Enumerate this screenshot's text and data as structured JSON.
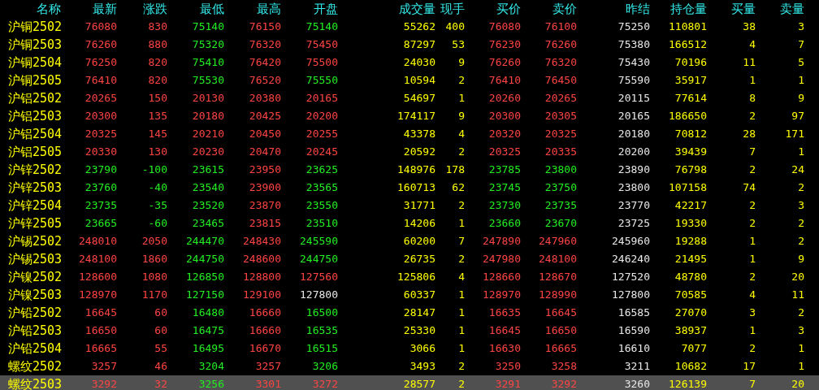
{
  "table": {
    "columns": [
      {
        "label": "名称"
      },
      {
        "label": "最新"
      },
      {
        "label": "涨跌"
      },
      {
        "label": "最低"
      },
      {
        "label": "最高"
      },
      {
        "label": "开盘"
      },
      {
        "label": "成交量"
      },
      {
        "label": "现手"
      },
      {
        "label": "买价"
      },
      {
        "label": "卖价"
      },
      {
        "label": "昨结"
      },
      {
        "label": "持仓量"
      },
      {
        "label": "买量"
      },
      {
        "label": "卖量"
      }
    ],
    "rows": [
      {
        "name": "沪铜2502",
        "selected": false,
        "last": {
          "text": "76080",
          "color": "#ff4444"
        },
        "change": {
          "text": "830",
          "color": "#ff4444"
        },
        "low": {
          "text": "75140",
          "color": "#22ee22"
        },
        "high": {
          "text": "76150",
          "color": "#ff4444"
        },
        "open": {
          "text": "75140",
          "color": "#22ee22"
        },
        "volume": "55262",
        "current": "400",
        "bid": {
          "text": "76080",
          "color": "#ff4444"
        },
        "ask": {
          "text": "76100",
          "color": "#ff4444"
        },
        "prev_settle": "75250",
        "open_interest": "110801",
        "bid_vol": "38",
        "ask_vol": "3"
      },
      {
        "name": "沪铜2503",
        "selected": false,
        "last": {
          "text": "76260",
          "color": "#ff4444"
        },
        "change": {
          "text": "880",
          "color": "#ff4444"
        },
        "low": {
          "text": "75320",
          "color": "#22ee22"
        },
        "high": {
          "text": "76320",
          "color": "#ff4444"
        },
        "open": {
          "text": "75450",
          "color": "#ff4444"
        },
        "volume": "87297",
        "current": "53",
        "bid": {
          "text": "76230",
          "color": "#ff4444"
        },
        "ask": {
          "text": "76260",
          "color": "#ff4444"
        },
        "prev_settle": "75380",
        "open_interest": "166512",
        "bid_vol": "4",
        "ask_vol": "7"
      },
      {
        "name": "沪铜2504",
        "selected": false,
        "last": {
          "text": "76250",
          "color": "#ff4444"
        },
        "change": {
          "text": "820",
          "color": "#ff4444"
        },
        "low": {
          "text": "75410",
          "color": "#22ee22"
        },
        "high": {
          "text": "76420",
          "color": "#ff4444"
        },
        "open": {
          "text": "75500",
          "color": "#ff4444"
        },
        "volume": "24030",
        "current": "9",
        "bid": {
          "text": "76260",
          "color": "#ff4444"
        },
        "ask": {
          "text": "76320",
          "color": "#ff4444"
        },
        "prev_settle": "75430",
        "open_interest": "70196",
        "bid_vol": "11",
        "ask_vol": "5"
      },
      {
        "name": "沪铜2505",
        "selected": false,
        "last": {
          "text": "76410",
          "color": "#ff4444"
        },
        "change": {
          "text": "820",
          "color": "#ff4444"
        },
        "low": {
          "text": "75530",
          "color": "#22ee22"
        },
        "high": {
          "text": "76520",
          "color": "#ff4444"
        },
        "open": {
          "text": "75550",
          "color": "#22ee22"
        },
        "volume": "10594",
        "current": "2",
        "bid": {
          "text": "76410",
          "color": "#ff4444"
        },
        "ask": {
          "text": "76450",
          "color": "#ff4444"
        },
        "prev_settle": "75590",
        "open_interest": "35917",
        "bid_vol": "1",
        "ask_vol": "1"
      },
      {
        "name": "沪铝2502",
        "selected": false,
        "last": {
          "text": "20265",
          "color": "#ff4444"
        },
        "change": {
          "text": "150",
          "color": "#ff4444"
        },
        "low": {
          "text": "20130",
          "color": "#ff4444"
        },
        "high": {
          "text": "20380",
          "color": "#ff4444"
        },
        "open": {
          "text": "20165",
          "color": "#ff4444"
        },
        "volume": "54697",
        "current": "1",
        "bid": {
          "text": "20260",
          "color": "#ff4444"
        },
        "ask": {
          "text": "20265",
          "color": "#ff4444"
        },
        "prev_settle": "20115",
        "open_interest": "77614",
        "bid_vol": "8",
        "ask_vol": "9"
      },
      {
        "name": "沪铝2503",
        "selected": false,
        "last": {
          "text": "20300",
          "color": "#ff4444"
        },
        "change": {
          "text": "135",
          "color": "#ff4444"
        },
        "low": {
          "text": "20180",
          "color": "#ff4444"
        },
        "high": {
          "text": "20425",
          "color": "#ff4444"
        },
        "open": {
          "text": "20200",
          "color": "#ff4444"
        },
        "volume": "174117",
        "current": "9",
        "bid": {
          "text": "20300",
          "color": "#ff4444"
        },
        "ask": {
          "text": "20305",
          "color": "#ff4444"
        },
        "prev_settle": "20165",
        "open_interest": "186650",
        "bid_vol": "2",
        "ask_vol": "97"
      },
      {
        "name": "沪铝2504",
        "selected": false,
        "last": {
          "text": "20325",
          "color": "#ff4444"
        },
        "change": {
          "text": "145",
          "color": "#ff4444"
        },
        "low": {
          "text": "20210",
          "color": "#ff4444"
        },
        "high": {
          "text": "20450",
          "color": "#ff4444"
        },
        "open": {
          "text": "20255",
          "color": "#ff4444"
        },
        "volume": "43378",
        "current": "4",
        "bid": {
          "text": "20320",
          "color": "#ff4444"
        },
        "ask": {
          "text": "20325",
          "color": "#ff4444"
        },
        "prev_settle": "20180",
        "open_interest": "70812",
        "bid_vol": "28",
        "ask_vol": "171"
      },
      {
        "name": "沪铝2505",
        "selected": false,
        "last": {
          "text": "20330",
          "color": "#ff4444"
        },
        "change": {
          "text": "130",
          "color": "#ff4444"
        },
        "low": {
          "text": "20230",
          "color": "#ff4444"
        },
        "high": {
          "text": "20470",
          "color": "#ff4444"
        },
        "open": {
          "text": "20245",
          "color": "#ff4444"
        },
        "volume": "20592",
        "current": "2",
        "bid": {
          "text": "20325",
          "color": "#ff4444"
        },
        "ask": {
          "text": "20335",
          "color": "#ff4444"
        },
        "prev_settle": "20200",
        "open_interest": "39439",
        "bid_vol": "7",
        "ask_vol": "1"
      },
      {
        "name": "沪锌2502",
        "selected": false,
        "last": {
          "text": "23790",
          "color": "#22ee22"
        },
        "change": {
          "text": "-100",
          "color": "#22ee22"
        },
        "low": {
          "text": "23615",
          "color": "#22ee22"
        },
        "high": {
          "text": "23950",
          "color": "#ff4444"
        },
        "open": {
          "text": "23625",
          "color": "#22ee22"
        },
        "volume": "148976",
        "current": "178",
        "bid": {
          "text": "23785",
          "color": "#22ee22"
        },
        "ask": {
          "text": "23800",
          "color": "#22ee22"
        },
        "prev_settle": "23890",
        "open_interest": "76798",
        "bid_vol": "2",
        "ask_vol": "24"
      },
      {
        "name": "沪锌2503",
        "selected": false,
        "last": {
          "text": "23760",
          "color": "#22ee22"
        },
        "change": {
          "text": "-40",
          "color": "#22ee22"
        },
        "low": {
          "text": "23540",
          "color": "#22ee22"
        },
        "high": {
          "text": "23900",
          "color": "#ff4444"
        },
        "open": {
          "text": "23565",
          "color": "#22ee22"
        },
        "volume": "160713",
        "current": "62",
        "bid": {
          "text": "23745",
          "color": "#22ee22"
        },
        "ask": {
          "text": "23750",
          "color": "#22ee22"
        },
        "prev_settle": "23800",
        "open_interest": "107158",
        "bid_vol": "74",
        "ask_vol": "2"
      },
      {
        "name": "沪锌2504",
        "selected": false,
        "last": {
          "text": "23735",
          "color": "#22ee22"
        },
        "change": {
          "text": "-35",
          "color": "#22ee22"
        },
        "low": {
          "text": "23520",
          "color": "#22ee22"
        },
        "high": {
          "text": "23870",
          "color": "#ff4444"
        },
        "open": {
          "text": "23550",
          "color": "#22ee22"
        },
        "volume": "31771",
        "current": "2",
        "bid": {
          "text": "23730",
          "color": "#22ee22"
        },
        "ask": {
          "text": "23735",
          "color": "#22ee22"
        },
        "prev_settle": "23770",
        "open_interest": "42217",
        "bid_vol": "2",
        "ask_vol": "3"
      },
      {
        "name": "沪锌2505",
        "selected": false,
        "last": {
          "text": "23665",
          "color": "#22ee22"
        },
        "change": {
          "text": "-60",
          "color": "#22ee22"
        },
        "low": {
          "text": "23465",
          "color": "#22ee22"
        },
        "high": {
          "text": "23815",
          "color": "#ff4444"
        },
        "open": {
          "text": "23510",
          "color": "#22ee22"
        },
        "volume": "14206",
        "current": "1",
        "bid": {
          "text": "23660",
          "color": "#22ee22"
        },
        "ask": {
          "text": "23670",
          "color": "#22ee22"
        },
        "prev_settle": "23725",
        "open_interest": "19330",
        "bid_vol": "2",
        "ask_vol": "2"
      },
      {
        "name": "沪锡2502",
        "selected": false,
        "last": {
          "text": "248010",
          "color": "#ff4444"
        },
        "change": {
          "text": "2050",
          "color": "#ff4444"
        },
        "low": {
          "text": "244470",
          "color": "#22ee22"
        },
        "high": {
          "text": "248430",
          "color": "#ff4444"
        },
        "open": {
          "text": "245590",
          "color": "#22ee22"
        },
        "volume": "60200",
        "current": "7",
        "bid": {
          "text": "247890",
          "color": "#ff4444"
        },
        "ask": {
          "text": "247960",
          "color": "#ff4444"
        },
        "prev_settle": "245960",
        "open_interest": "19288",
        "bid_vol": "1",
        "ask_vol": "2"
      },
      {
        "name": "沪锡2503",
        "selected": false,
        "last": {
          "text": "248100",
          "color": "#ff4444"
        },
        "change": {
          "text": "1860",
          "color": "#ff4444"
        },
        "low": {
          "text": "244750",
          "color": "#22ee22"
        },
        "high": {
          "text": "248600",
          "color": "#ff4444"
        },
        "open": {
          "text": "244750",
          "color": "#22ee22"
        },
        "volume": "26735",
        "current": "2",
        "bid": {
          "text": "247980",
          "color": "#ff4444"
        },
        "ask": {
          "text": "248100",
          "color": "#ff4444"
        },
        "prev_settle": "246240",
        "open_interest": "21495",
        "bid_vol": "1",
        "ask_vol": "9"
      },
      {
        "name": "沪镍2502",
        "selected": false,
        "last": {
          "text": "128600",
          "color": "#ff4444"
        },
        "change": {
          "text": "1080",
          "color": "#ff4444"
        },
        "low": {
          "text": "126850",
          "color": "#22ee22"
        },
        "high": {
          "text": "128800",
          "color": "#ff4444"
        },
        "open": {
          "text": "127560",
          "color": "#ff4444"
        },
        "volume": "125806",
        "current": "4",
        "bid": {
          "text": "128660",
          "color": "#ff4444"
        },
        "ask": {
          "text": "128670",
          "color": "#ff4444"
        },
        "prev_settle": "127520",
        "open_interest": "48780",
        "bid_vol": "2",
        "ask_vol": "20"
      },
      {
        "name": "沪镍2503",
        "selected": false,
        "last": {
          "text": "128970",
          "color": "#ff4444"
        },
        "change": {
          "text": "1170",
          "color": "#ff4444"
        },
        "low": {
          "text": "127150",
          "color": "#22ee22"
        },
        "high": {
          "text": "129100",
          "color": "#ff4444"
        },
        "open": {
          "text": "127800",
          "color": "#e8e8e8"
        },
        "volume": "60337",
        "current": "1",
        "bid": {
          "text": "128970",
          "color": "#ff4444"
        },
        "ask": {
          "text": "128990",
          "color": "#ff4444"
        },
        "prev_settle": "127800",
        "open_interest": "70585",
        "bid_vol": "4",
        "ask_vol": "11"
      },
      {
        "name": "沪铅2502",
        "selected": false,
        "last": {
          "text": "16645",
          "color": "#ff4444"
        },
        "change": {
          "text": "60",
          "color": "#ff4444"
        },
        "low": {
          "text": "16480",
          "color": "#22ee22"
        },
        "high": {
          "text": "16660",
          "color": "#ff4444"
        },
        "open": {
          "text": "16500",
          "color": "#22ee22"
        },
        "volume": "28147",
        "current": "1",
        "bid": {
          "text": "16635",
          "color": "#ff4444"
        },
        "ask": {
          "text": "16645",
          "color": "#ff4444"
        },
        "prev_settle": "16585",
        "open_interest": "27070",
        "bid_vol": "3",
        "ask_vol": "2"
      },
      {
        "name": "沪铅2503",
        "selected": false,
        "last": {
          "text": "16650",
          "color": "#ff4444"
        },
        "change": {
          "text": "60",
          "color": "#ff4444"
        },
        "low": {
          "text": "16475",
          "color": "#22ee22"
        },
        "high": {
          "text": "16660",
          "color": "#ff4444"
        },
        "open": {
          "text": "16535",
          "color": "#22ee22"
        },
        "volume": "25330",
        "current": "1",
        "bid": {
          "text": "16645",
          "color": "#ff4444"
        },
        "ask": {
          "text": "16650",
          "color": "#ff4444"
        },
        "prev_settle": "16590",
        "open_interest": "38937",
        "bid_vol": "1",
        "ask_vol": "3"
      },
      {
        "name": "沪铅2504",
        "selected": false,
        "last": {
          "text": "16665",
          "color": "#ff4444"
        },
        "change": {
          "text": "55",
          "color": "#ff4444"
        },
        "low": {
          "text": "16495",
          "color": "#22ee22"
        },
        "high": {
          "text": "16670",
          "color": "#ff4444"
        },
        "open": {
          "text": "16515",
          "color": "#22ee22"
        },
        "volume": "3066",
        "current": "1",
        "bid": {
          "text": "16630",
          "color": "#ff4444"
        },
        "ask": {
          "text": "16665",
          "color": "#ff4444"
        },
        "prev_settle": "16610",
        "open_interest": "7077",
        "bid_vol": "2",
        "ask_vol": "1"
      },
      {
        "name": "螺纹2502",
        "selected": false,
        "last": {
          "text": "3257",
          "color": "#ff4444"
        },
        "change": {
          "text": "46",
          "color": "#ff4444"
        },
        "low": {
          "text": "3204",
          "color": "#22ee22"
        },
        "high": {
          "text": "3257",
          "color": "#ff4444"
        },
        "open": {
          "text": "3206",
          "color": "#22ee22"
        },
        "volume": "3493",
        "current": "2",
        "bid": {
          "text": "3250",
          "color": "#ff4444"
        },
        "ask": {
          "text": "3258",
          "color": "#ff4444"
        },
        "prev_settle": "3211",
        "open_interest": "10682",
        "bid_vol": "17",
        "ask_vol": "1"
      },
      {
        "name": "螺纹2503",
        "selected": true,
        "last": {
          "text": "3292",
          "color": "#ff4444"
        },
        "change": {
          "text": "32",
          "color": "#ff4444"
        },
        "low": {
          "text": "3256",
          "color": "#22ee22"
        },
        "high": {
          "text": "3301",
          "color": "#ff4444"
        },
        "open": {
          "text": "3272",
          "color": "#ff4444"
        },
        "volume": "28577",
        "current": "2",
        "bid": {
          "text": "3291",
          "color": "#ff4444"
        },
        "ask": {
          "text": "3292",
          "color": "#ff4444"
        },
        "prev_settle": "3260",
        "open_interest": "126139",
        "bid_vol": "7",
        "ask_vol": "20"
      }
    ]
  }
}
